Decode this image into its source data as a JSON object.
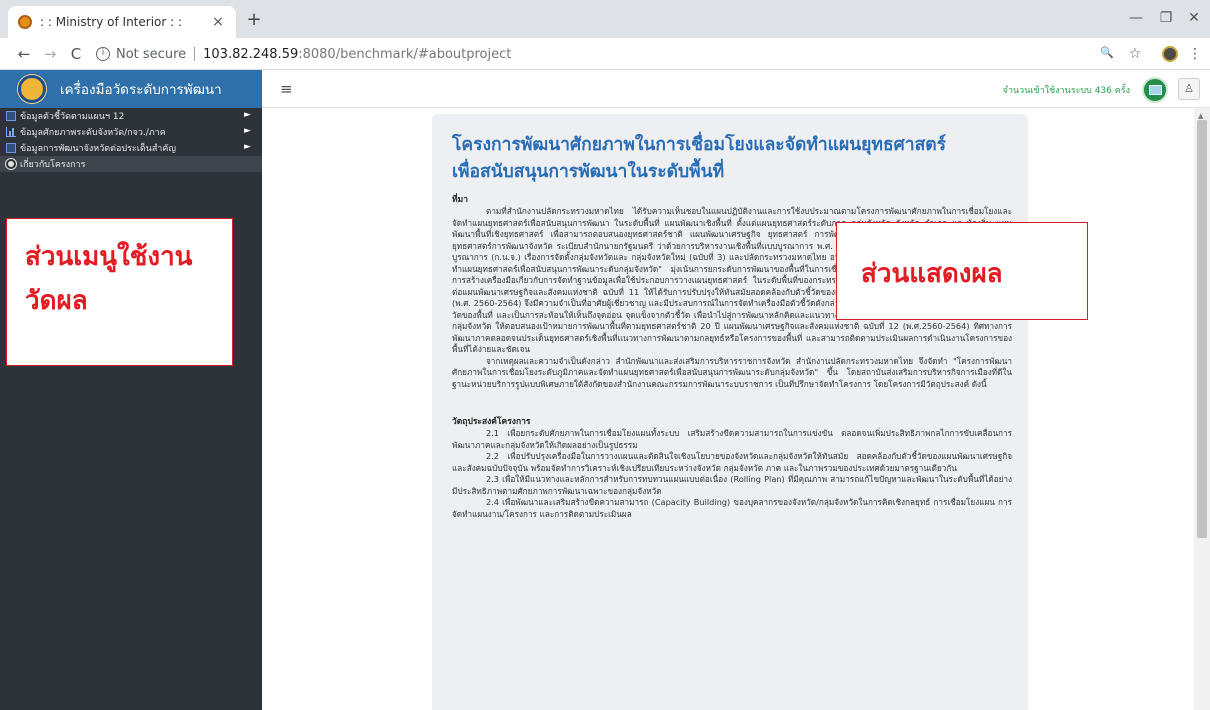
{
  "browser": {
    "tab_title": ": : Ministry of Interior : :",
    "tab_close": "×",
    "new_tab": "+",
    "nav": {
      "back": "←",
      "forward": "→",
      "reload": "C"
    },
    "info_icon": "i",
    "not_secure": "Not secure",
    "url_host": "103.82.248.59",
    "url_rest": ":8080/benchmark/#aboutproject",
    "icons": {
      "zoom": "🔍",
      "star": "☆",
      "menu": "⋮"
    },
    "window_controls": {
      "minimize": "—",
      "maximize": "❐",
      "close": "✕"
    }
  },
  "app": {
    "brand_title": "เครื่องมือวัดระดับการพัฒนา",
    "hamburger": "≡",
    "visit_count_text": "จำนวนเข้าใช้งานระบบ 436 ครั้ง",
    "user_icon": "♙"
  },
  "sidebar": {
    "items": [
      {
        "label": "ข้อมูลตัวชี้วัดตามแผนฯ 12",
        "arrow": "►"
      },
      {
        "label": "ข้อมูลศักยภาพระดับจังหวัด/กจว./ภาค",
        "arrow": "►"
      },
      {
        "label": "ข้อมูลการพัฒนาจังหวัดต่อประเด็นสำคัญ",
        "arrow": "►"
      },
      {
        "label": "เกี่ยวกับโครงการ",
        "arrow": ""
      }
    ]
  },
  "annotations": {
    "menu_line1": "ส่วนเมนูใช้งาน",
    "menu_line2": "วัดผล",
    "display": "ส่วนแสดงผล"
  },
  "content": {
    "title_line1": "โครงการพัฒนาศักยภาพในการเชื่อมโยงและจัดทำแผนยุทธศาสตร์",
    "title_line2": "เพื่อสนับสนุนการพัฒนาในระดับพื้นที่",
    "background_heading": "ที่มา",
    "background_p1": "ตามที่สำนักงานปลัดกระทรวงมหาดไทย ได้รับความเห็นชอบในแผนปฏิบัติงานและการใช้งบประมาณตามโครงการพัฒนาศักยภาพในการเชื่อมโยงและจัดทำแผนยุทธศาสตร์เพื่อสนับสนุนการพัฒนา ในระดับพื้นที่ แผนพัฒนาเชิงพื้นที่ ตั้งแต่แผนยุทธศาสตร์ระดับภาค กลุ่มจังหวัด จังหวัด อำเภอ และท้องถิ่น แผนพัฒนาพื้นที่เชิงยุทธศาสตร์ เพื่อสามารถตอบสนองยุทธศาสตร์ชาติ แผนพัฒนาเศรษฐกิจ ยุทธศาสตร์ การพัฒนาภาค ยุทธศาสตร์การพัฒนากลุ่มจังหวัด และยุทธศาสตร์การพัฒนาจังหวัด ระเบียบสำนักนายกรัฐมนตรี ว่าด้วยการบริหารงานเชิงพื้นที่แบบบูรณาการ พ.ศ. 2560 และ บริหารงานจังหวัดและกลุ่มจังหวัดแบบบูรณาการ (ก.น.จ.) เรื่องการจัดตั้งกลุ่มจังหวัดและ กลุ่มจังหวัดใหม่ (ฉบับที่ 3) และปลัดกระทรวงมหาดไทย อนุมัติให้ดำเนินกิจกรรม \"การพัฒนา ภูมิภาคและจัดทำแผนยุทธศาสตร์เพื่อสนับสนุนการพัฒนาระดับกลุ่มจังหวัด\" มุ่งเน้นการยกระดับการพัฒนาของพื้นที่ในการเชื่อมโยงยุทธศาสตร์ระดับภาคและกลุ่มจังหวัด ด้วยการสร้างเครื่องมือเกี่ยวกับการจัดทำฐานข้อมูลเพื่อใช้ประกอบการวางแผนยุทธศาสตร์ ในระดับพื้นที่ของกระทรวงมหาดไทย ซึ่งถูกพัฒนาขึ้นให้สามารถตอบสนองต่อแผนพัฒนาเศรษฐกิจและสังคมแห่งชาติ ฉบับที่ 11 ให้ได้รับการปรับปรุงให้ทันสมัยสอดคล้องกับตัวชี้วัดของแผนพัฒนาเศรษฐกิจและสังคมแห่งชาติ ฉบับที่ 12 (พ.ศ. 2560-2564) จึงมีความจำเป็นที่อาศัยผู้เชี่ยวชาญ และมีประสบการณ์ในการจัดทำเครื่องมือตัวชี้วัดดังกล่าว และสามารถเชื่อมโยงตัวชี้วัดระดับชาติไปสู่ตัวชี้วัดของพื้นที่ และเป็นการสะท้อนให้เห็นถึงจุดอ่อน จุดแข็งจากตัวชี้วัด เพื่อนำไปสู่การพัฒนาหลักคิดและแนวทางการเชื่อมโยงโครงการของพื้นที่ระดับภาคกับระดับกลุ่มจังหวัด ให้ตอบสนองเป้าหมายการพัฒนาพื้นที่ตามยุทธศาสตร์ชาติ 20 ปี แผนพัฒนาเศรษฐกิจและสังคมแห่งชาติ ฉบับที่ 12 (พ.ศ.2560-2564) ทิศทางการพัฒนาภาคตลอดจนประเด็นยุทธศาสตร์เชิงพื้นที่แนวทางการพัฒนาตามกลยุทธ์หรือโครงการของพื้นที่ และสามารถติดตามประเมินผลการดำเนินงานโครงการของพื้นที่ได้ง่ายและชัดเจน",
    "background_p2": "จากเหตุผลและความจำเป็นดังกล่าว สำนักพัฒนาและส่งเสริมการบริหารราชการจังหวัด สำนักงานปลัดกระทรวงมหาดไทย จึงจัดทำ \"โครงการพัฒนาศักยภาพในการเชื่อมโยงระดับภูมิภาคและจัดทำแผนยุทธศาสตร์เพื่อสนับสนุนการพัฒนาระดับกลุ่มจังหวัด\" ขึ้น โดยสถาบันส่งเสริมการบริหารกิจการเมืองที่ดีในฐานะหน่วยบริการรูปแบบพิเศษภายใต้สังกัดของสำนักงานคณะกรรมการพัฒนาระบบราชการ เป็นที่ปรึกษาจัดทำโครงการ โดยโครงการมีวัตถุประสงค์ ดังนี้",
    "objectives_heading": "วัตถุประสงค์โครงการ",
    "objectives": [
      "2.1 เพื่อยกระดับศักยภาพในการเชื่อมโยงแผนทั้งระบบ เสริมสร้างขีดความสามารถในการแข่งขัน ตลอดจนเพิ่มประสิทธิภาพกลไกการขับเคลื่อนการพัฒนาภาคและกลุ่มจังหวัดให้เกิดผลอย่างเป็นรูปธรรม",
      "2.2 เพื่อปรับปรุงเครื่องมือในการวางแผนและตัดสินใจเชิงนโยบายของจังหวัดและกลุ่มจังหวัดให้ทันสมัย สอดคล้องกับตัวชี้วัดของแผนพัฒนาเศรษฐกิจและสังคมฉบับปัจจุบัน พร้อมจัดทำการวิเคราะห์เชิงเปรียบเทียบระหว่างจังหวัด กลุ่มจังหวัด ภาค และในภาพรวมของประเทศด้วยมาตรฐานเดียวกัน",
      "2.3 เพื่อให้มีแนวทางและหลักการสำหรับการทบทวนแผนแบบต่อเนื่อง (Rolling Plan) ที่มีคุณภาพ สามารถแก้ไขปัญหาและพัฒนาในระดับพื้นที่ได้อย่างมีประสิทธิภาพตามศักยภาพการพัฒนาเฉพาะของกลุ่มจังหวัด",
      "2.4 เพื่อพัฒนาและเสริมสร้างขีดความสามารถ (Capacity Building) ของบุคลากรของจังหวัด/กลุ่มจังหวัดในการคิดเชิงกลยุทธ์ การเชื่อมโยงแผน การจัดทำแผนงาน/โครงการ และการติดตามประเมินผล"
    ]
  }
}
